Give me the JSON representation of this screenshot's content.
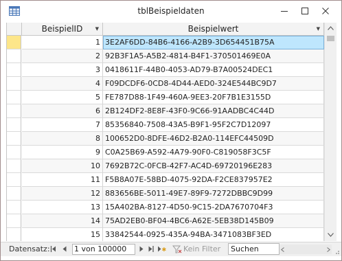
{
  "window": {
    "title": "tblBeispieldaten"
  },
  "table": {
    "columns": [
      "BeispielID",
      "Beispielwert"
    ],
    "rows": [
      {
        "id": "1",
        "value": "3E2AF6DD-84B6-4166-A2B9-3D654451B75A"
      },
      {
        "id": "2",
        "value": "92B3F1A5-A5B2-4814-B4F1-370501469E0A"
      },
      {
        "id": "3",
        "value": "0418611F-44B0-4053-AD79-B7A00524DEC1"
      },
      {
        "id": "4",
        "value": "F09DCDF6-0CD8-4D44-AED0-324E544BC9D7"
      },
      {
        "id": "5",
        "value": "FE787D88-1F49-460A-9EE3-20F7B1E3155D"
      },
      {
        "id": "6",
        "value": "2B124DF2-8E8F-43F0-9C66-91AADBC4C44D"
      },
      {
        "id": "7",
        "value": "85356840-7508-43A5-B9F1-95F2C7D12097"
      },
      {
        "id": "8",
        "value": "100652D0-8DFE-46D2-B2A0-114EFC44509D"
      },
      {
        "id": "9",
        "value": "C0A25B69-A592-4A79-90F0-C819058F3C5F"
      },
      {
        "id": "10",
        "value": "7692B72C-0FCB-42F7-AC4D-69720196E283"
      },
      {
        "id": "11",
        "value": "F5B8A07E-58BD-4075-92DA-F2CE837957E2"
      },
      {
        "id": "12",
        "value": "883656BE-5011-49E7-89F9-7272DBBC9D99"
      },
      {
        "id": "13",
        "value": "15A402BA-8127-4D50-9C15-2DA7670704F3"
      },
      {
        "id": "14",
        "value": "75AD2EB0-BF04-4BC6-A62E-5EB38D145B09"
      },
      {
        "id": "15",
        "value": "33842544-0925-435A-94BA-3471083BF3ED"
      }
    ],
    "current_row": 1
  },
  "navigation": {
    "label": "Datensatz:",
    "record_position": "1 von 100000",
    "filter_label": "Kein Filter",
    "search_value": "Suchen"
  },
  "icons": {
    "app": "table-icon",
    "minimize": "minimize-icon",
    "maximize": "maximize-icon",
    "close": "close-icon",
    "first": "first-record-icon",
    "prev": "previous-record-icon",
    "next": "next-record-icon",
    "last": "last-record-icon",
    "new": "new-record-icon",
    "filter": "no-filter-icon"
  },
  "colors": {
    "selection": "#bee6fd",
    "current_selector": "#fde68a",
    "header": "#f3f3f3"
  }
}
